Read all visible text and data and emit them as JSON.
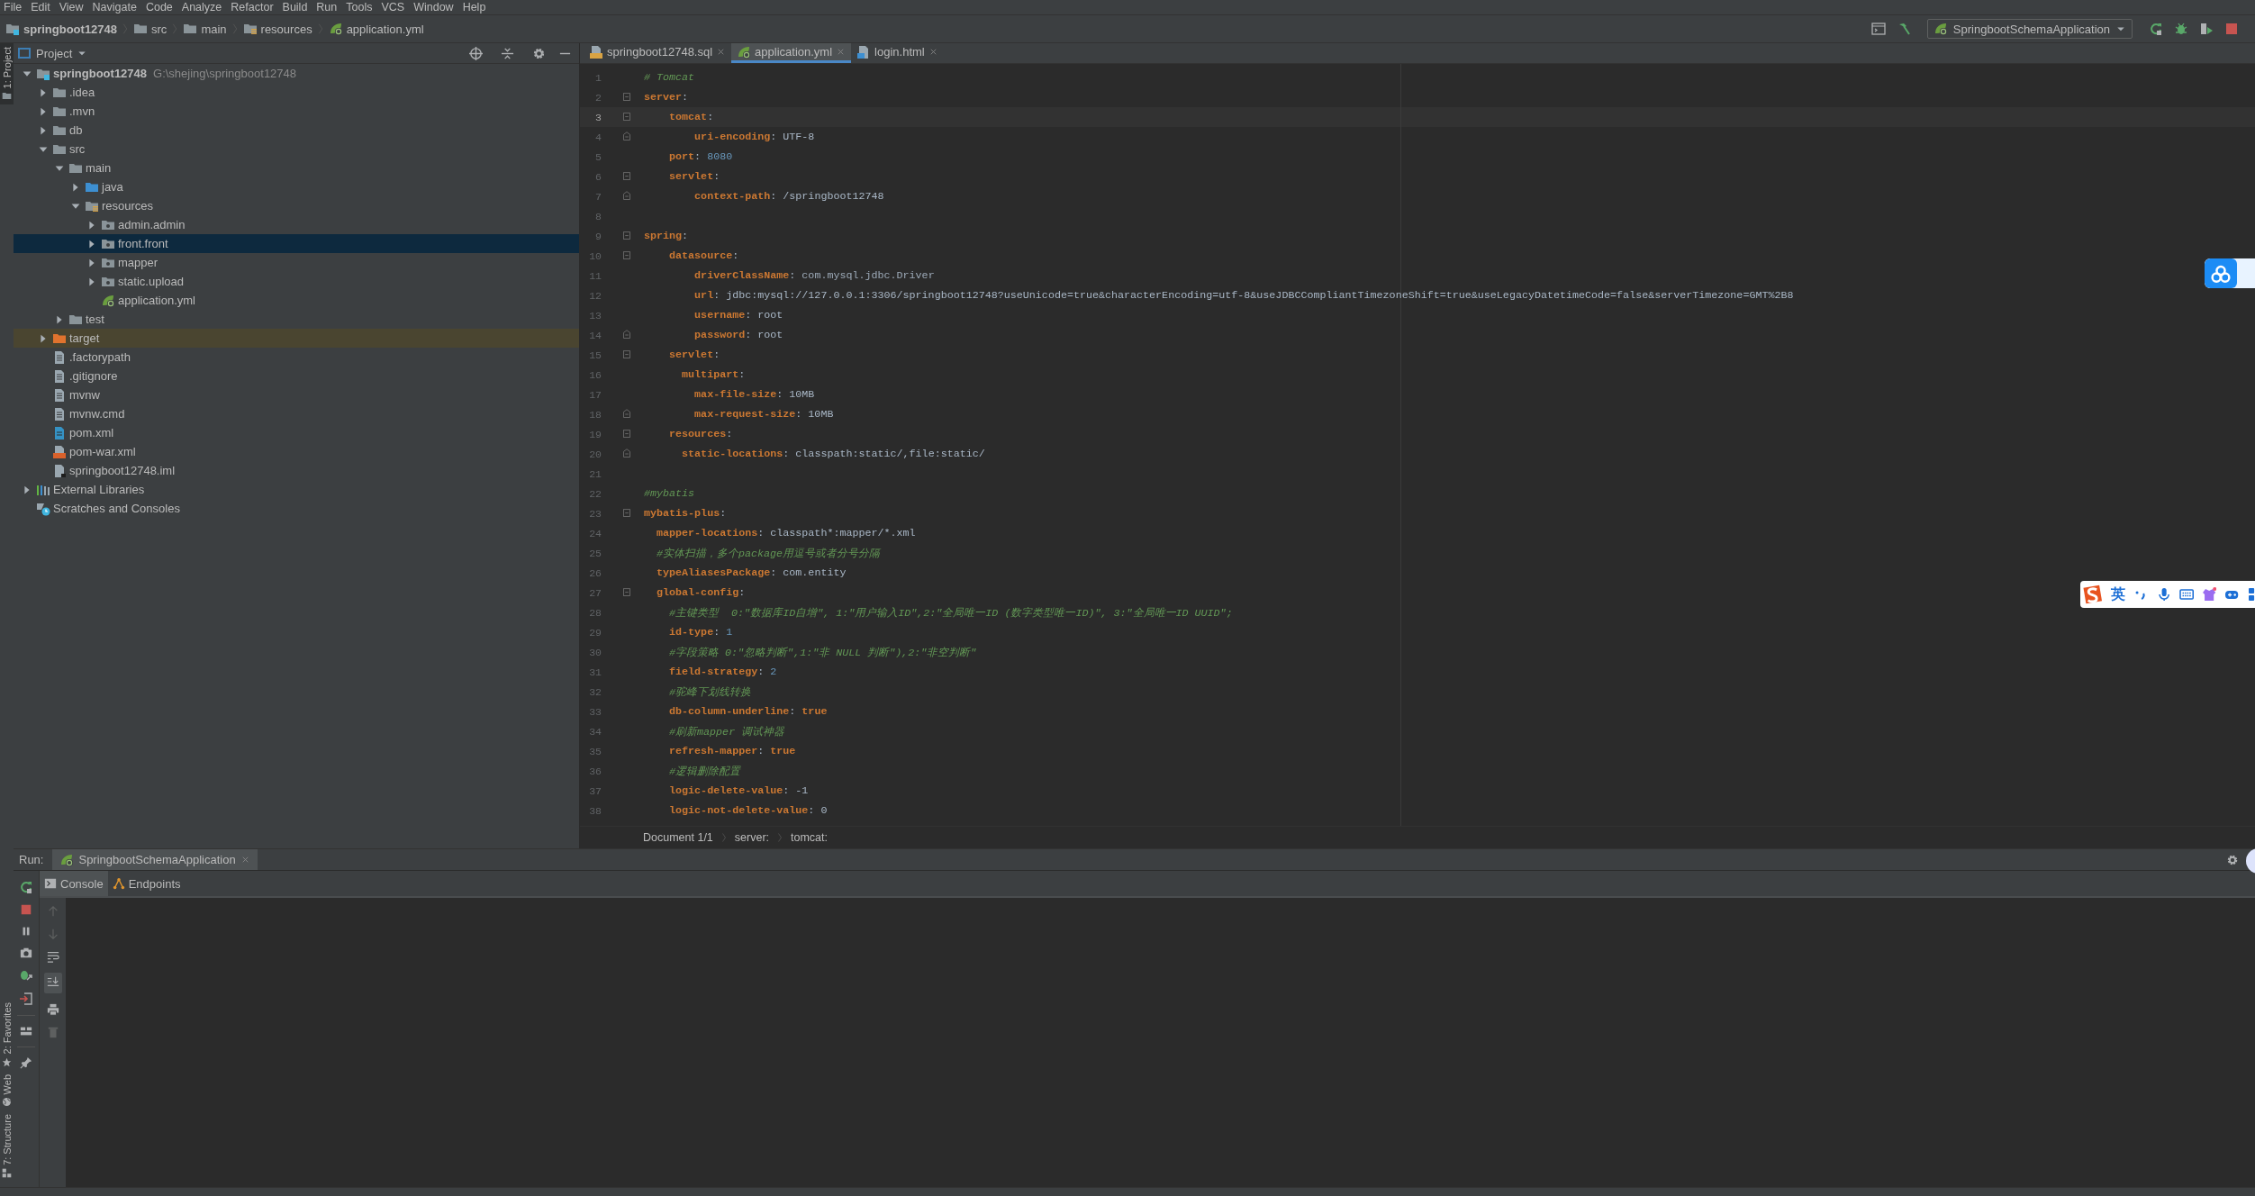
{
  "menu": [
    "File",
    "Edit",
    "View",
    "Navigate",
    "Code",
    "Analyze",
    "Refactor",
    "Build",
    "Run",
    "Tools",
    "VCS",
    "Window",
    "Help"
  ],
  "breadcrumbs": [
    {
      "label": "springboot12748",
      "kind": "module"
    },
    {
      "label": "src",
      "kind": "folder"
    },
    {
      "label": "main",
      "kind": "folder"
    },
    {
      "label": "resources",
      "kind": "resource_folder"
    },
    {
      "label": "application.yml",
      "kind": "yml_file"
    }
  ],
  "run_configuration": "SpringbootSchemaApplication",
  "side_stripe": [
    {
      "label": "1: Project",
      "kind": "project",
      "selected": true
    },
    {
      "label": "2: Favorites",
      "kind": "favorites",
      "selected": false
    },
    {
      "label": "Web",
      "kind": "web",
      "selected": false
    },
    {
      "label": "7: Structure",
      "kind": "structure",
      "selected": false
    }
  ],
  "project": {
    "title": "Project",
    "tree": [
      {
        "label": "springboot12748",
        "hint": "G:\\shejing\\springboot12748",
        "kind": "module",
        "expanded": true,
        "selected": false,
        "children": [
          {
            "label": ".idea",
            "kind": "folder",
            "expanded": false,
            "selected": false
          },
          {
            "label": ".mvn",
            "kind": "folder",
            "expanded": false,
            "selected": false
          },
          {
            "label": "db",
            "kind": "folder",
            "expanded": false,
            "selected": false
          },
          {
            "label": "src",
            "kind": "folder",
            "expanded": true,
            "selected": false,
            "children": [
              {
                "label": "main",
                "kind": "folder",
                "expanded": true,
                "selected": false,
                "children": [
                  {
                    "label": "java",
                    "kind": "source_folder",
                    "expanded": false,
                    "selected": false
                  },
                  {
                    "label": "resources",
                    "kind": "resource_folder",
                    "expanded": true,
                    "selected": false,
                    "children": [
                      {
                        "label": "admin.admin",
                        "kind": "package",
                        "expanded": false,
                        "selected": false
                      },
                      {
                        "label": "front.front",
                        "kind": "package",
                        "expanded": false,
                        "selected": true
                      },
                      {
                        "label": "mapper",
                        "kind": "package",
                        "expanded": false,
                        "selected": false
                      },
                      {
                        "label": "static.upload",
                        "kind": "package",
                        "expanded": false,
                        "selected": false
                      },
                      {
                        "label": "application.yml",
                        "kind": "yml_file",
                        "selected": false
                      }
                    ]
                  }
                ]
              },
              {
                "label": "test",
                "kind": "folder",
                "expanded": false,
                "selected": false
              }
            ]
          },
          {
            "label": "target",
            "kind": "excluded_folder",
            "expanded": false,
            "selected": false
          },
          {
            "label": ".factorypath",
            "kind": "file",
            "selected": false
          },
          {
            "label": ".gitignore",
            "kind": "file",
            "selected": false
          },
          {
            "label": "mvnw",
            "kind": "file",
            "selected": false
          },
          {
            "label": "mvnw.cmd",
            "kind": "file",
            "selected": false
          },
          {
            "label": "pom.xml",
            "kind": "maven_file",
            "selected": false
          },
          {
            "label": "pom-war.xml",
            "kind": "xml_file",
            "selected": false
          },
          {
            "label": "springboot12748.iml",
            "kind": "iml_file",
            "selected": false
          }
        ]
      },
      {
        "label": "External Libraries",
        "kind": "libraries",
        "expanded": false,
        "selected": false
      },
      {
        "label": "Scratches and Consoles",
        "kind": "scratches",
        "selected": false
      }
    ]
  },
  "editor": {
    "tabs": [
      {
        "label": "springboot12748.sql",
        "kind": "sql_file",
        "selected": false
      },
      {
        "label": "application.yml",
        "kind": "yml_file",
        "selected": true
      },
      {
        "label": "login.html",
        "kind": "html_file",
        "selected": false
      }
    ],
    "lines": [
      {
        "number": "1",
        "current": false,
        "tokens": [
          {
            "text": "# Tomcat",
            "kind": "comment"
          }
        ]
      },
      {
        "number": "2",
        "current": false,
        "fold_start": true,
        "tokens": [
          {
            "text": "server",
            "kind": "key"
          },
          {
            "text": ":",
            "kind": "plain"
          }
        ]
      },
      {
        "number": "3",
        "current": true,
        "fold_start": true,
        "tokens": [
          {
            "text": "    tomcat",
            "kind": "key"
          },
          {
            "text": ":",
            "kind": "plain"
          }
        ]
      },
      {
        "number": "4",
        "current": false,
        "fold_end": true,
        "tokens": [
          {
            "text": "        uri-encoding",
            "kind": "key"
          },
          {
            "text": ": UTF-8",
            "kind": "plain"
          }
        ]
      },
      {
        "number": "5",
        "current": false,
        "tokens": [
          {
            "text": "    port",
            "kind": "key"
          },
          {
            "text": ": ",
            "kind": "plain"
          },
          {
            "text": "8080",
            "kind": "number"
          }
        ]
      },
      {
        "number": "6",
        "current": false,
        "fold_start": true,
        "tokens": [
          {
            "text": "    servlet",
            "kind": "key"
          },
          {
            "text": ":",
            "kind": "plain"
          }
        ]
      },
      {
        "number": "7",
        "current": false,
        "fold_end": true,
        "tokens": [
          {
            "text": "        context-path",
            "kind": "key"
          },
          {
            "text": ": /springboot12748",
            "kind": "plain"
          }
        ]
      },
      {
        "number": "8",
        "current": false
      },
      {
        "number": "9",
        "current": false,
        "fold_start": true,
        "tokens": [
          {
            "text": "spring",
            "kind": "key"
          },
          {
            "text": ":",
            "kind": "plain"
          }
        ]
      },
      {
        "number": "10",
        "current": false,
        "fold_start": true,
        "tokens": [
          {
            "text": "    datasource",
            "kind": "key"
          },
          {
            "text": ":",
            "kind": "plain"
          }
        ]
      },
      {
        "number": "11",
        "current": false,
        "tokens": [
          {
            "text": "        driverClassName",
            "kind": "key"
          },
          {
            "text": ": ",
            "kind": "plain"
          },
          {
            "text": "com.mysql.jdbc.Driver",
            "kind": "reference"
          }
        ]
      },
      {
        "number": "12",
        "current": false,
        "tokens": [
          {
            "text": "        url",
            "kind": "key"
          },
          {
            "text": ": jdbc:mysql://127.0.0.1:3306/springboot12748?useUnicode=true&characterEncoding=utf-8&useJDBCCompliantTimezoneShift=true&useLegacyDatetimeCode=false&serverTimezone=GMT%2B8",
            "kind": "plain"
          }
        ]
      },
      {
        "number": "13",
        "current": false,
        "tokens": [
          {
            "text": "        username",
            "kind": "key"
          },
          {
            "text": ": root",
            "kind": "plain"
          }
        ]
      },
      {
        "number": "14",
        "current": false,
        "fold_end": true,
        "tokens": [
          {
            "text": "        password",
            "kind": "key"
          },
          {
            "text": ": root",
            "kind": "plain"
          }
        ]
      },
      {
        "number": "15",
        "current": false,
        "fold_start": true,
        "tokens": [
          {
            "text": "    servlet",
            "kind": "key"
          },
          {
            "text": ":",
            "kind": "plain"
          }
        ]
      },
      {
        "number": "16",
        "current": false,
        "tokens": [
          {
            "text": "      multipart",
            "kind": "key"
          },
          {
            "text": ":",
            "kind": "plain"
          }
        ]
      },
      {
        "number": "17",
        "current": false,
        "tokens": [
          {
            "text": "        max-file-size",
            "kind": "key"
          },
          {
            "text": ": 10MB",
            "kind": "plain"
          }
        ]
      },
      {
        "number": "18",
        "current": false,
        "fold_end": true,
        "tokens": [
          {
            "text": "        max-request-size",
            "kind": "key"
          },
          {
            "text": ": 10MB",
            "kind": "plain"
          }
        ]
      },
      {
        "number": "19",
        "current": false,
        "fold_start": true,
        "tokens": [
          {
            "text": "    resources",
            "kind": "key"
          },
          {
            "text": ":",
            "kind": "plain"
          }
        ]
      },
      {
        "number": "20",
        "current": false,
        "fold_end": true,
        "tokens": [
          {
            "text": "      static-locations",
            "kind": "key"
          },
          {
            "text": ": classpath:static/,file:static/",
            "kind": "plain"
          }
        ]
      },
      {
        "number": "21",
        "current": false
      },
      {
        "number": "22",
        "current": false,
        "tokens": [
          {
            "text": "#mybatis",
            "kind": "comment"
          }
        ]
      },
      {
        "number": "23",
        "current": false,
        "fold_start": true,
        "tokens": [
          {
            "text": "mybatis-plus",
            "kind": "key"
          },
          {
            "text": ":",
            "kind": "plain"
          }
        ]
      },
      {
        "number": "24",
        "current": false,
        "tokens": [
          {
            "text": "  mapper-locations",
            "kind": "key"
          },
          {
            "text": ": classpath*:mapper/*.xml",
            "kind": "plain"
          }
        ]
      },
      {
        "number": "25",
        "current": false,
        "tokens": [
          {
            "text": "  #实体扫描，多个package用逗号或者分号分隔",
            "kind": "comment"
          }
        ]
      },
      {
        "number": "26",
        "current": false,
        "tokens": [
          {
            "text": "  typeAliasesPackage",
            "kind": "key"
          },
          {
            "text": ": com.entity",
            "kind": "plain"
          }
        ]
      },
      {
        "number": "27",
        "current": false,
        "fold_start": true,
        "tokens": [
          {
            "text": "  global-config",
            "kind": "key"
          },
          {
            "text": ":",
            "kind": "plain"
          }
        ]
      },
      {
        "number": "28",
        "current": false,
        "tokens": [
          {
            "text": "    #主键类型  0:\"数据库ID自增\", 1:\"用户输入ID\",2:\"全局唯一ID (数字类型唯一ID)\", 3:\"全局唯一ID UUID\";",
            "kind": "comment"
          }
        ]
      },
      {
        "number": "29",
        "current": false,
        "tokens": [
          {
            "text": "    id-type",
            "kind": "key"
          },
          {
            "text": ": ",
            "kind": "plain"
          },
          {
            "text": "1",
            "kind": "number"
          }
        ]
      },
      {
        "number": "30",
        "current": false,
        "tokens": [
          {
            "text": "    #字段策略 0:\"忽略判断\",1:\"非 NULL 判断\"),2:\"非空判断\"",
            "kind": "comment"
          }
        ]
      },
      {
        "number": "31",
        "current": false,
        "tokens": [
          {
            "text": "    field-strategy",
            "kind": "key"
          },
          {
            "text": ": ",
            "kind": "plain"
          },
          {
            "text": "2",
            "kind": "number"
          }
        ]
      },
      {
        "number": "32",
        "current": false,
        "tokens": [
          {
            "text": "    #驼峰下划线转换",
            "kind": "comment"
          }
        ]
      },
      {
        "number": "33",
        "current": false,
        "tokens": [
          {
            "text": "    db-column-underline",
            "kind": "key"
          },
          {
            "text": ": ",
            "kind": "plain"
          },
          {
            "text": "true",
            "kind": "keyword"
          }
        ]
      },
      {
        "number": "34",
        "current": false,
        "tokens": [
          {
            "text": "    #刷新mapper 调试神器",
            "kind": "comment"
          }
        ]
      },
      {
        "number": "35",
        "current": false,
        "tokens": [
          {
            "text": "    refresh-mapper",
            "kind": "key"
          },
          {
            "text": ": ",
            "kind": "plain"
          },
          {
            "text": "true",
            "kind": "keyword"
          }
        ]
      },
      {
        "number": "36",
        "current": false,
        "tokens": [
          {
            "text": "    #逻辑删除配置",
            "kind": "comment"
          }
        ]
      },
      {
        "number": "37",
        "current": false,
        "tokens": [
          {
            "text": "    logic-delete-value",
            "kind": "key"
          },
          {
            "text": ": -1",
            "kind": "plain"
          }
        ]
      },
      {
        "number": "38",
        "current": false,
        "tokens": [
          {
            "text": "    logic-not-delete-value",
            "kind": "key"
          },
          {
            "text": ": 0",
            "kind": "plain"
          }
        ]
      }
    ],
    "path": [
      "Document 1/1",
      "server:",
      "tomcat:"
    ]
  },
  "run": {
    "title": "Run:",
    "tab": "SpringbootSchemaApplication",
    "tabs": [
      {
        "label": "Console",
        "kind": "console",
        "selected": true
      },
      {
        "label": "Endpoints",
        "kind": "endpoints",
        "selected": false
      }
    ]
  },
  "ime_bar": {
    "mode": "英"
  }
}
